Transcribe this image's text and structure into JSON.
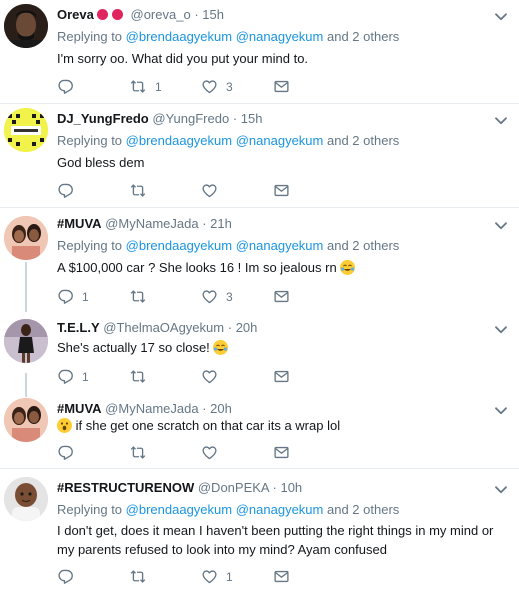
{
  "tweets": [
    {
      "name": "Oreva",
      "handle": "@oreva_o",
      "time": "15h",
      "reply_prefix": "Replying to",
      "mention1": "@brendaagyekum",
      "mention2": "@nanagyekum",
      "reply_suffix": "and 2 others",
      "text": "I'm sorry oo. What did you put your mind to.",
      "replies": "",
      "retweets": "1",
      "likes": "3"
    },
    {
      "name": "DJ_YungFredo",
      "handle": "@YungFredo",
      "time": "15h",
      "reply_prefix": "Replying to",
      "mention1": "@brendaagyekum",
      "mention2": "@nanagyekum",
      "reply_suffix": "and 2 others",
      "text": "God bless dem",
      "replies": "",
      "retweets": "",
      "likes": ""
    },
    {
      "name": "#MUVA",
      "handle": "@MyNameJada",
      "time": "21h",
      "reply_prefix": "Replying to",
      "mention1": "@brendaagyekum",
      "mention2": "@nanagyekum",
      "reply_suffix": "and 2 others",
      "text": "A $100,000 car ? She looks 16 ! Im so jealous rn",
      "replies": "1",
      "retweets": "",
      "likes": "3"
    },
    {
      "name": "T.E.L.Y",
      "handle": "@ThelmaOAgyekum",
      "time": "20h",
      "text": "She's actually 17 so close!",
      "replies": "1",
      "retweets": "",
      "likes": ""
    },
    {
      "name": "#MUVA",
      "handle": "@MyNameJada",
      "time": "20h",
      "text": "if she get one scratch on that car its a wrap lol",
      "replies": "",
      "retweets": "",
      "likes": ""
    },
    {
      "name": "#RESTRUCTURENOW",
      "handle": "@DonPEKA",
      "time": "10h",
      "reply_prefix": "Replying to",
      "mention1": "@brendaagyekum",
      "mention2": "@nanagyekum",
      "reply_suffix": "and 2 others",
      "text": "I don't get,  does it mean I haven't been putting  the right things in my mind or my parents refused to look into my mind?  Ayam confused",
      "replies": "",
      "retweets": "",
      "likes": "1"
    }
  ],
  "separator": "·",
  "colors": {
    "name": "#14171a",
    "secondary": "#657786",
    "link": "#1b95e0",
    "divider": "#e6ecf0",
    "thread_line": "#ccd6dd",
    "badge": "#e0245e"
  },
  "icons": {
    "reply": "reply-icon",
    "retweet": "retweet-icon",
    "like": "heart-icon",
    "dm": "envelope-icon",
    "more": "chevron-down-icon"
  }
}
